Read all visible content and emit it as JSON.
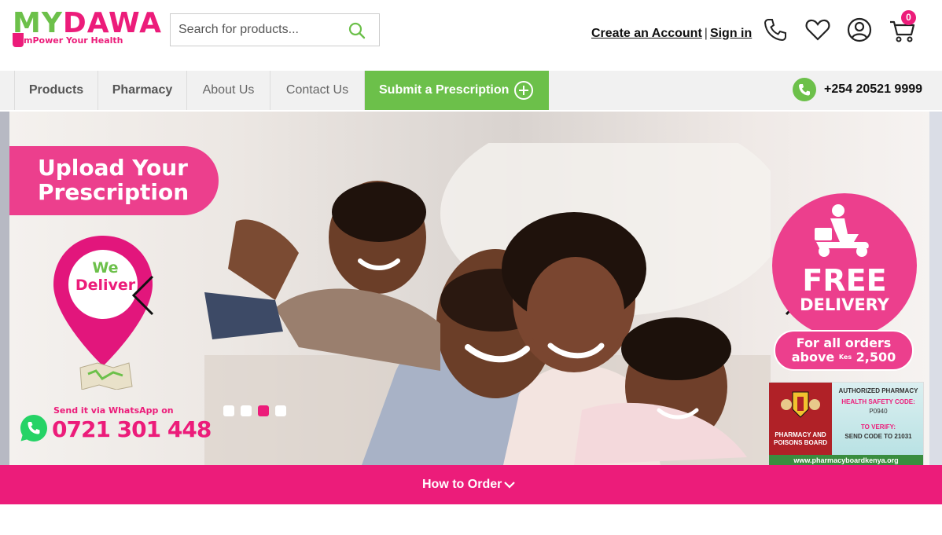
{
  "logo": {
    "brand_part1": "MY",
    "brand_part2": "DAWA",
    "tagline": "mPower Your Health"
  },
  "search": {
    "placeholder": "Search for products...",
    "value": ""
  },
  "account": {
    "create_label": "Create an Account",
    "separator": "|",
    "signin_label": "Sign in"
  },
  "cart": {
    "count": "0"
  },
  "nav": {
    "items": [
      {
        "label": "Products"
      },
      {
        "label": "Pharmacy"
      },
      {
        "label": "About Us"
      },
      {
        "label": "Contact Us"
      }
    ],
    "submit_label": "Submit a Prescription",
    "phone": "+254 20521 9999"
  },
  "hero": {
    "upload_line1": "Upload Your",
    "upload_line2": "Prescription",
    "deliver_line1": "We",
    "deliver_line2": "Deliver",
    "whatsapp_label": "Send it via WhatsApp on",
    "whatsapp_number": "0721 301 448",
    "free_line1": "FREE",
    "free_line2": "DELIVERY",
    "orders_line1": "For all orders",
    "orders_line2_a": "above",
    "orders_kes": "Kes",
    "orders_amount": "2,500",
    "slides_total": 4,
    "active_slide": 3,
    "ppb": {
      "authorized": "AUTHORIZED PHARMACY",
      "code_label": "HEALTH SAFETY CODE:",
      "code": "P0940",
      "verify": "TO VERIFY:",
      "send": "SEND CODE TO 21031",
      "board_line1": "PHARMACY AND",
      "board_line2": "POISONS BOARD",
      "url": "www.pharmacyboardkenya.org"
    }
  },
  "order_bar": {
    "label": "How to Order"
  },
  "colors": {
    "pink": "#ec1c7a",
    "green": "#6cc04a"
  }
}
